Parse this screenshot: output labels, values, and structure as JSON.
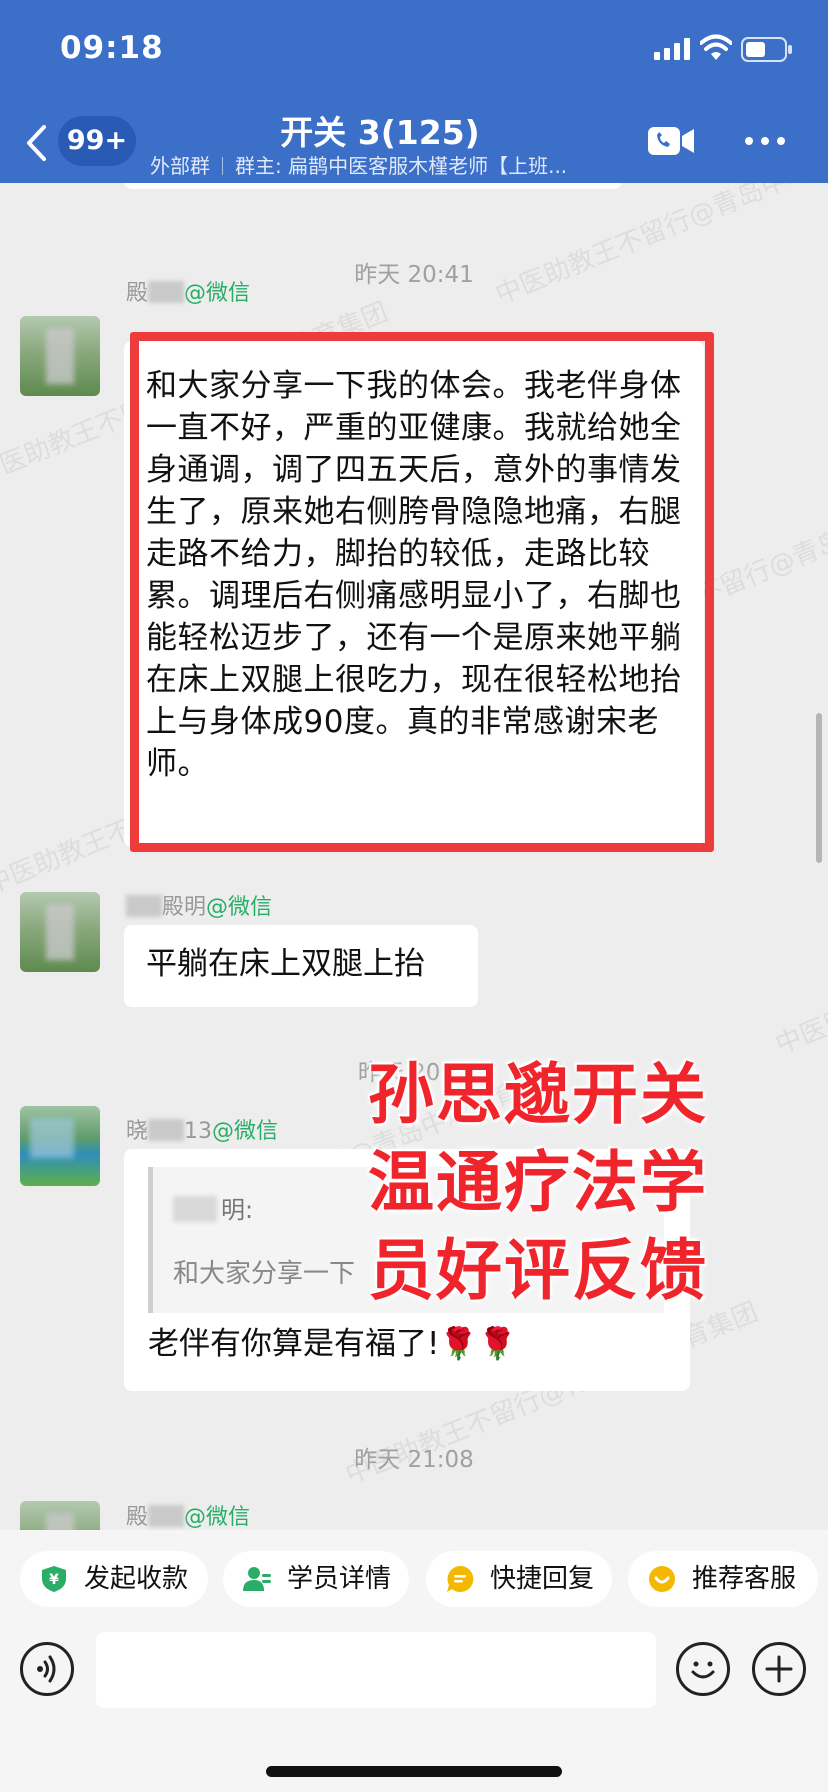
{
  "status_bar": {
    "time": "09:18"
  },
  "header": {
    "unread_count": "99+",
    "title": "开关 3(125)",
    "subtitle_left": "外部群",
    "subtitle_right": "群主: 扁鹊中医客服木槿老师【上班..."
  },
  "messages": [
    {
      "type": "time",
      "text": "昨天 20:41"
    },
    {
      "type": "text",
      "sender_visible": "殿",
      "sender_tag": "@微信",
      "text": "和大家分享一下我的体会。我老伴身体一直不好，严重的亚健康。我就给她全身通调，调了四五天后，意外的事情发生了，原来她右侧胯骨隐隐地痛，右腿走路不给力，脚抬的较低，走路比较累。调理后右侧痛感明显小了，右脚也能轻松迈步了，还有一个是原来她平躺在床上双腿上很吃力，现在很轻松地抬上与身体成90度。真的非常感谢宋老师。",
      "highlighted": true
    },
    {
      "type": "text",
      "sender_visible": "殿明",
      "sender_tag": "@微信",
      "text": "平躺在床上双腿上抬"
    },
    {
      "type": "time",
      "text": "昨天 20:..."
    },
    {
      "type": "reply",
      "sender_visible": "晓",
      "sender_suffix": "13",
      "sender_tag": "@微信",
      "quote_name": "明:",
      "quote_text": "和大家分享一下",
      "text": "老伴有你算是有福了!🌹🌹"
    },
    {
      "type": "time",
      "text": "昨天 21:08"
    },
    {
      "type": "text",
      "sender_visible": "殿",
      "sender_tag": "@微信"
    }
  ],
  "overlay_caption": [
    "孙思邈开关",
    "温通疗法学",
    "员好评反馈"
  ],
  "watermark_text": "中医助教王不留行@青岛中域教育集团",
  "quick_actions": [
    {
      "label": "发起收款",
      "icon": "payment-icon",
      "color": "#2aae67"
    },
    {
      "label": "学员详情",
      "icon": "student-icon",
      "color": "#2aae67"
    },
    {
      "label": "快捷回复",
      "icon": "quick-reply-icon",
      "color": "#f5b800"
    },
    {
      "label": "推荐客服",
      "icon": "recommend-service-icon",
      "color": "#f5b800"
    }
  ],
  "input": {
    "placeholder": ""
  },
  "colors": {
    "header_bg": "#3b6fc8",
    "highlight": "#ee3b3b",
    "wechat_tag": "#2aae67",
    "chat_bg": "#ededed"
  }
}
